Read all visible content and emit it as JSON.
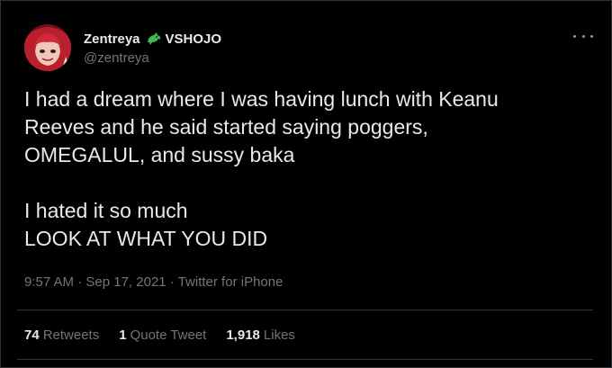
{
  "author": {
    "display_name": "Zentreya",
    "org_name": "VSHOJO",
    "handle": "@zentreya"
  },
  "tweet": {
    "lines_paragraph1": [
      "I had a dream where I was having lunch with Keanu",
      "Reeves and he said started saying poggers,",
      "OMEGALUL, and sussy baka"
    ],
    "lines_paragraph2": [
      "I hated it so much",
      "LOOK AT WHAT YOU DID"
    ]
  },
  "meta": {
    "time": "9:57 AM",
    "separator": "·",
    "date": "Sep 17, 2021",
    "source": "Twitter for iPhone"
  },
  "stats": {
    "retweets_count": "74",
    "retweets_label": "Retweets",
    "quote_count": "1",
    "quote_label": "Quote Tweet",
    "likes_count": "1,918",
    "likes_label": "Likes"
  },
  "icons": {
    "org_badge": "dragon-icon",
    "more": "more-options-icon"
  },
  "colors": {
    "background": "#000000",
    "text_primary": "#e7e9ea",
    "text_secondary": "#71767b",
    "border": "#2f3336",
    "badge_green": "#3fb950"
  }
}
